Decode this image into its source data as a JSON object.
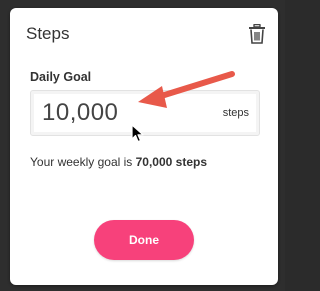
{
  "dialog": {
    "title": "Steps",
    "delete_icon": "trash-icon",
    "goal_label": "Daily Goal",
    "goal_value": "10,000",
    "goal_unit": "steps",
    "weekly_prefix": "Your weekly goal is ",
    "weekly_value": "70,000 steps",
    "done_label": "Done"
  },
  "annotation": {
    "arrow_icon": "red-arrow-icon",
    "arrow_color": "#e8594a"
  },
  "colors": {
    "accent": "#f7417b",
    "backdrop": "#2e2e2e",
    "card": "#ffffff"
  }
}
